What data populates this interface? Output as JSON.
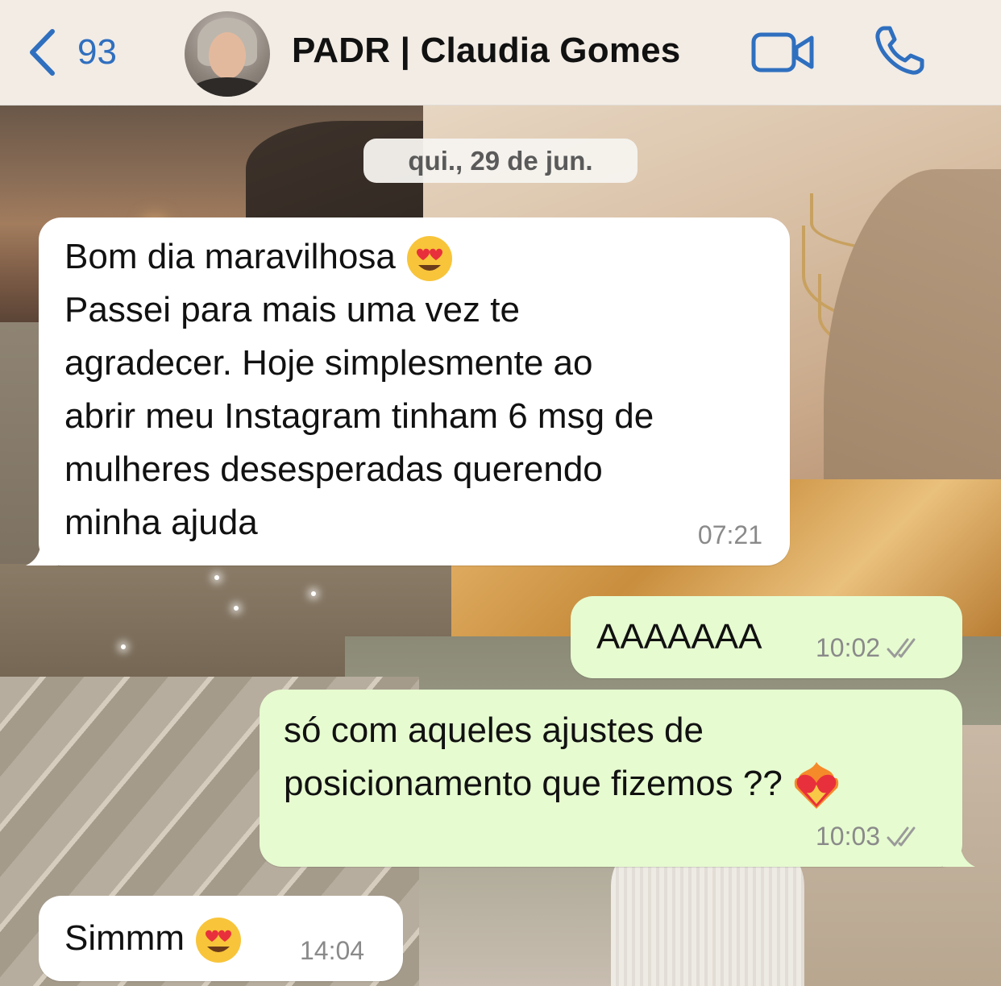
{
  "header": {
    "back_count": "93",
    "contact_name": "PADR | Claudia Gomes",
    "accent_color": "#2f6fbf"
  },
  "date_separator": "qui., 29 de jun.",
  "messages": [
    {
      "direction": "incoming",
      "line1": "Bom dia maravilhosa",
      "line2": "Passei para mais uma vez te\nagradecer. Hoje simplesmente ao\nabrir meu Instagram tinham 6 msg de\nmulheres desesperadas querendo\nminha ajuda",
      "time": "07:21"
    },
    {
      "direction": "outgoing",
      "text": "AAAAAAA",
      "time": "10:02",
      "status": "read"
    },
    {
      "direction": "outgoing",
      "line1": "só com aqueles ajustes de",
      "line2": "posicionamento que fizemos ??",
      "time": "10:03",
      "status": "read"
    },
    {
      "direction": "incoming",
      "text": "Simmm",
      "time": "14:04"
    }
  ],
  "icons": {
    "back": "chevron-left-icon",
    "video": "video-camera-icon",
    "call": "phone-icon",
    "heart_eyes": "heart-eyes-emoji",
    "heart_on_fire": "heart-on-fire-emoji",
    "read_receipt": "double-check-icon"
  },
  "colors": {
    "incoming_bubble": "#ffffff",
    "outgoing_bubble": "#e6fbd0"
  }
}
